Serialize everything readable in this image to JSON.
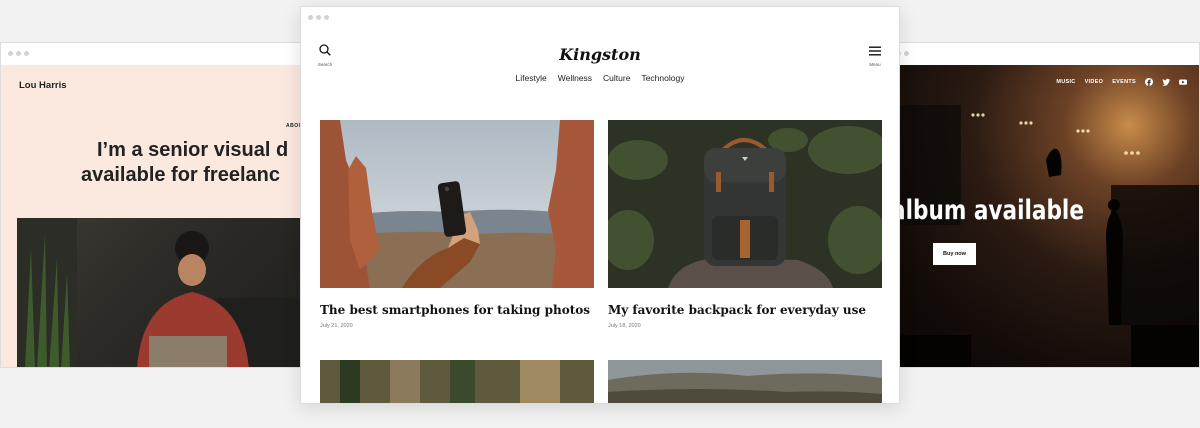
{
  "left_window": {
    "name": "Lou Harris",
    "nav_about": "ABOUT",
    "headline_line1": "I’m a senior visual d",
    "headline_line2": "available for freelanc"
  },
  "center_window": {
    "site_title": "Kingston",
    "search_label": "Search",
    "menu_label": "Menu",
    "nav": [
      "Lifestyle",
      "Wellness",
      "Culture",
      "Technology"
    ],
    "posts": [
      {
        "title": "The best smartphones for taking photos",
        "date": "July 21, 2020"
      },
      {
        "title": "My favorite backpack for everyday use",
        "date": "July 18, 2020"
      }
    ]
  },
  "right_window": {
    "nav": [
      "MUSIC",
      "VIDEO",
      "EVENTS"
    ],
    "social_icons": [
      "facebook-icon",
      "twitter-icon",
      "youtube-icon"
    ],
    "headline": "album available",
    "button_label": "Buy now"
  }
}
